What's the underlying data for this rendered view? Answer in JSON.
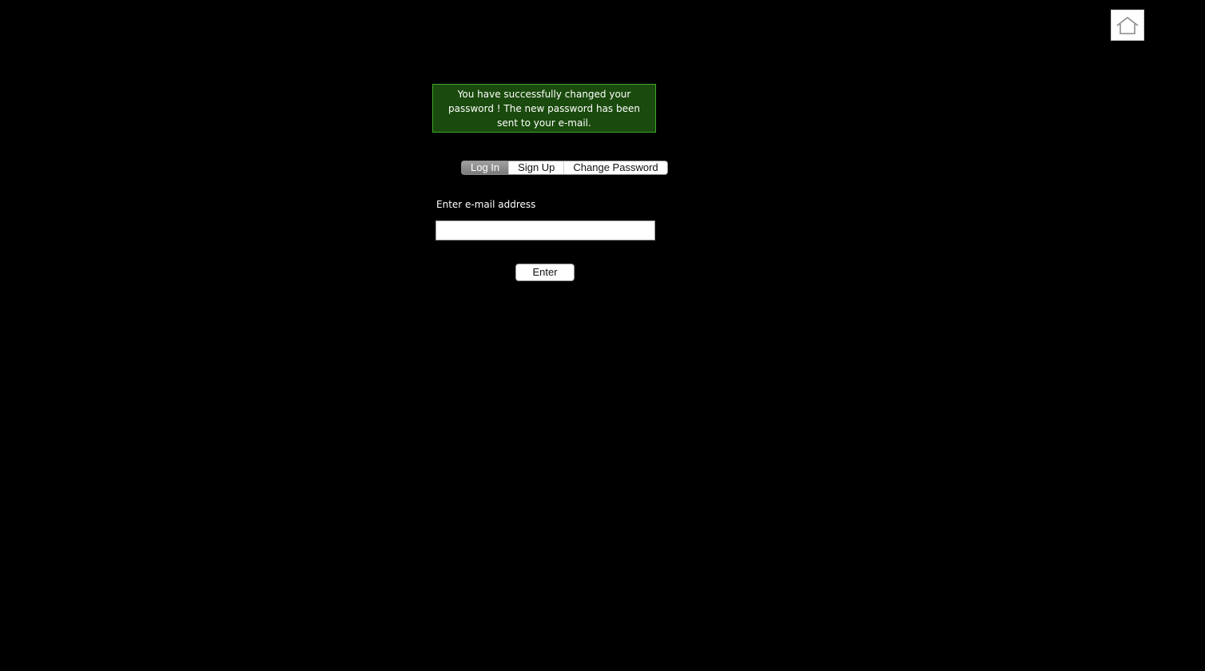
{
  "header": {
    "home_icon": "home-icon"
  },
  "notification": {
    "message": "You have successfully changed your password ! The new password has been sent to your e-mail.",
    "background_color": "#1a4a0d",
    "border_color": "#3fa82a"
  },
  "tabs": [
    {
      "label": "Log In",
      "active": true
    },
    {
      "label": "Sign Up",
      "active": false
    },
    {
      "label": "Change Password",
      "active": false
    }
  ],
  "form": {
    "email_label": "Enter e-mail address",
    "email_value": "",
    "email_placeholder": "",
    "submit_label": "Enter"
  },
  "colors": {
    "page_background": "#000000"
  }
}
